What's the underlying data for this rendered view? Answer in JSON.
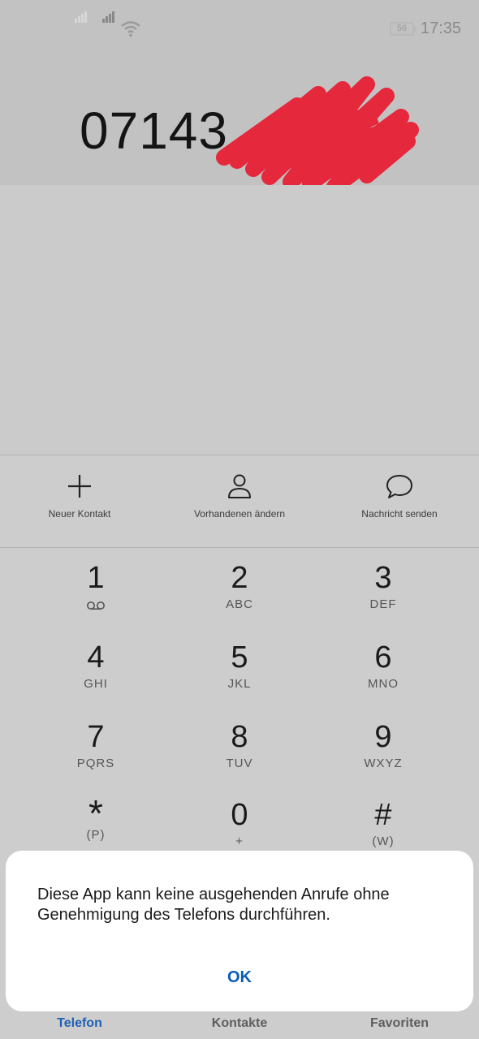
{
  "status_bar": {
    "battery": "56",
    "time": "17:35"
  },
  "dialed_number": "07143",
  "quick_actions": [
    {
      "label": "Neuer Kontakt",
      "icon": "plus-icon"
    },
    {
      "label": "Vorhandenen ändern",
      "icon": "person-icon"
    },
    {
      "label": "Nachricht senden",
      "icon": "chat-bubble-icon"
    }
  ],
  "keypad": [
    {
      "digit": "1",
      "letters": ""
    },
    {
      "digit": "2",
      "letters": "ABC"
    },
    {
      "digit": "3",
      "letters": "DEF"
    },
    {
      "digit": "4",
      "letters": "GHI"
    },
    {
      "digit": "5",
      "letters": "JKL"
    },
    {
      "digit": "6",
      "letters": "MNO"
    },
    {
      "digit": "7",
      "letters": "PQRS"
    },
    {
      "digit": "8",
      "letters": "TUV"
    },
    {
      "digit": "9",
      "letters": "WXYZ"
    },
    {
      "digit": "*",
      "letters": "(P)"
    },
    {
      "digit": "0",
      "letters": "+"
    },
    {
      "digit": "#",
      "letters": "(W)"
    }
  ],
  "dialog": {
    "message": "Diese App kann keine ausgehenden Anrufe ohne Genehmigung des Telefons durchführen.",
    "ok_label": "OK"
  },
  "bottom_tabs": [
    {
      "label": "Telefon",
      "active": true
    },
    {
      "label": "Kontakte",
      "active": false
    },
    {
      "label": "Favoriten",
      "active": false
    }
  ],
  "colors": {
    "accent": "#1f5fb5",
    "dialog_button": "#0a5db3",
    "redaction": "#e5283c"
  }
}
